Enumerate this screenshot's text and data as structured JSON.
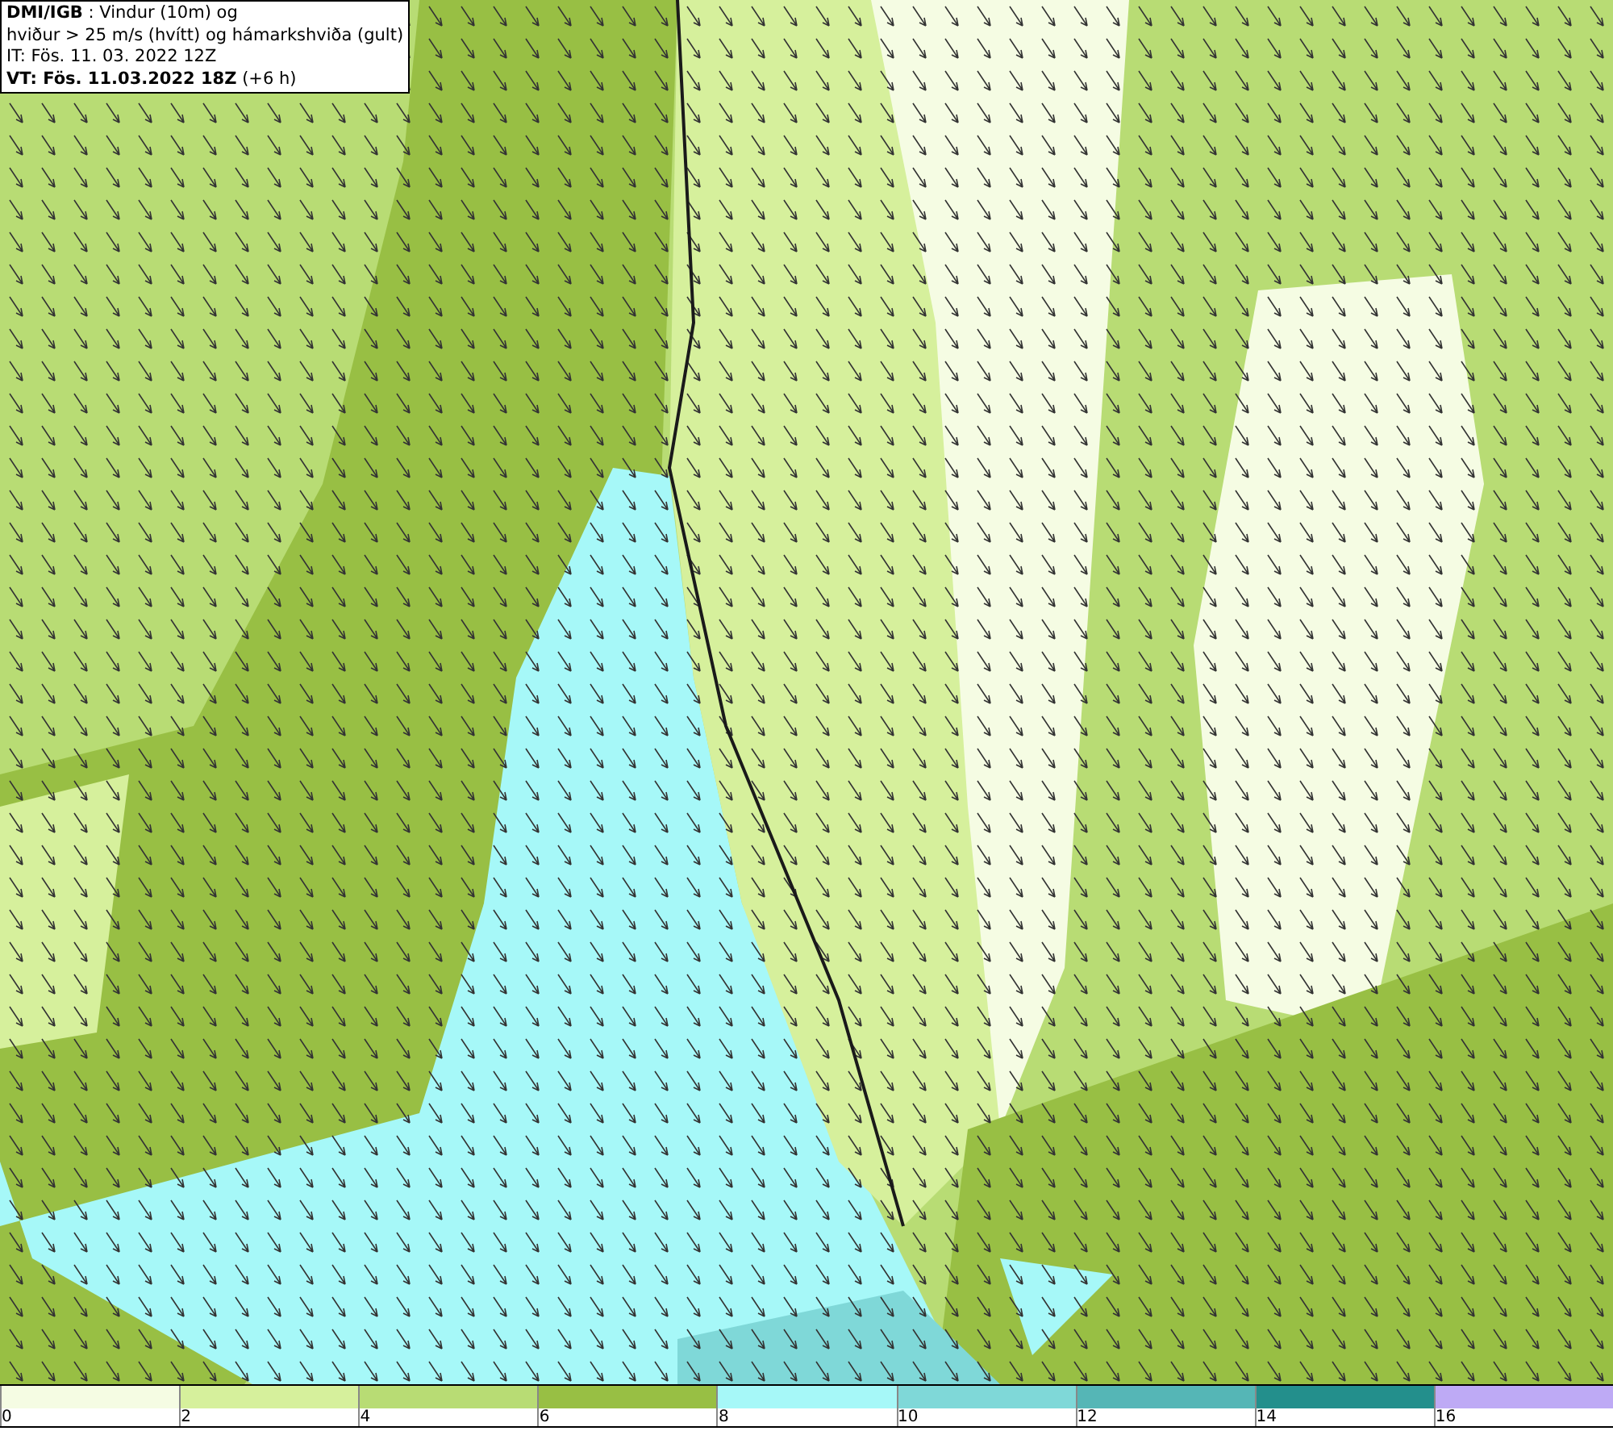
{
  "header": {
    "lines": [
      "**DMI/IGB** : Vindur (10m) og",
      "hviður > 25 m/s (hvítt) og hámarkshviða (gult)",
      "IT: Fös. 11. 03. 2022 12Z",
      "**VT: Fös. 11.03.2022 18Z** (+6 h)"
    ]
  },
  "legend": [
    {
      "label": "0",
      "color": "#f5fce3"
    },
    {
      "label": "2",
      "color": "#d6f09c"
    },
    {
      "label": "4",
      "color": "#b8dc74"
    },
    {
      "label": "6",
      "color": "#98bf44"
    },
    {
      "label": "8",
      "color": "#a6f8f8"
    },
    {
      "label": "10",
      "color": "#7fd8d8"
    },
    {
      "label": "12",
      "color": "#55b6b6"
    },
    {
      "label": "14",
      "color": "#238f8c"
    },
    {
      "label": "16",
      "color": "#beaaf5"
    }
  ]
}
